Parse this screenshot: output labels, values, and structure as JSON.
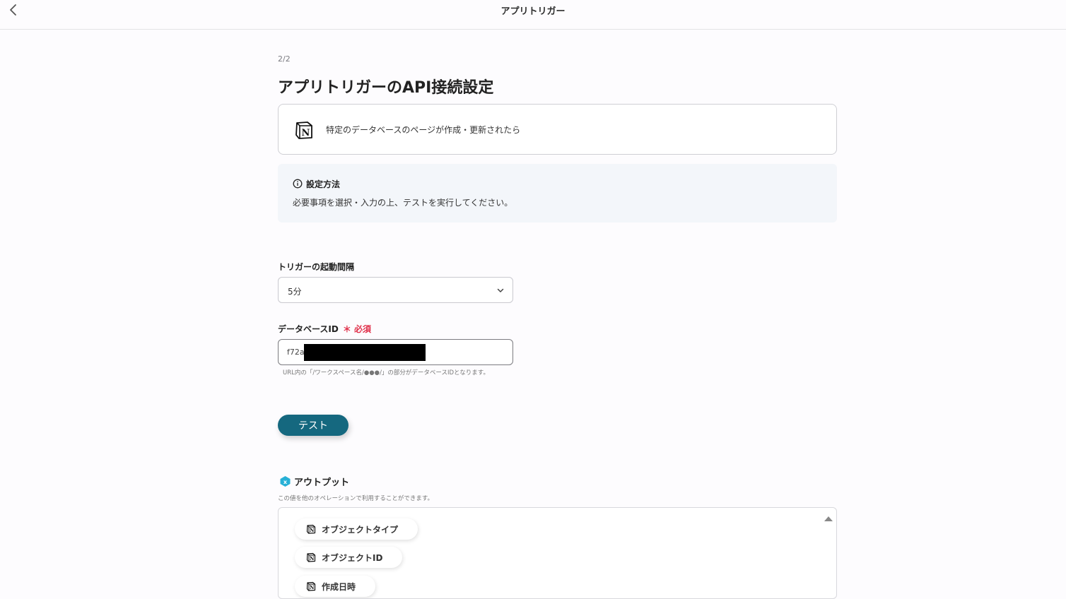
{
  "header": {
    "title": "アプリトリガー",
    "back_icon": "chevron-left-icon"
  },
  "main": {
    "step": "2/2",
    "title": "アプリトリガーのAPI接続設定",
    "trigger_card": {
      "icon": "notion-icon",
      "text": "特定のデータベースのページが作成・更新されたら"
    },
    "info": {
      "icon": "info-icon",
      "title": "設定方法",
      "text": "必要事項を選択・入力の上、テストを実行してください。"
    },
    "interval": {
      "label": "トリガーの起動間隔",
      "value": "5分"
    },
    "database_id": {
      "label": "データベースID",
      "required": "＊ 必須",
      "value": "f72a",
      "hint": "URL内の「/ワークスペース名/●●●/」の部分がデータベースIDとなります。"
    },
    "test_button": "テスト",
    "output": {
      "title": "アウトプット",
      "description": "この値を他のオペレーションで利用することができます。",
      "items": [
        "オブジェクトタイプ",
        "オブジェクトID",
        "作成日時"
      ]
    }
  },
  "colors": {
    "accent": "#15687f",
    "required": "#e0304a",
    "info_bg": "#f3f6fa"
  }
}
